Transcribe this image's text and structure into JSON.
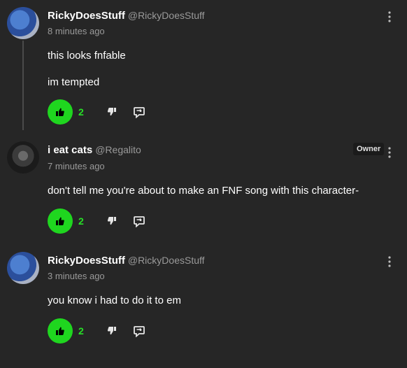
{
  "comments": [
    {
      "author": "RickyDoesStuff",
      "handle": "@RickyDoesStuff",
      "time": "8 minutes ago",
      "lines": [
        "this looks fnfable",
        "im tempted"
      ],
      "likes": "2"
    },
    {
      "author": "i eat cats",
      "handle": "@Regalito",
      "time": "7 minutes ago",
      "badge": "Owner",
      "lines": [
        "don't tell me you're about to make an FNF song with this character-"
      ],
      "likes": "2"
    },
    {
      "author": "RickyDoesStuff",
      "handle": "@RickyDoesStuff",
      "time": "3 minutes ago",
      "lines": [
        "you know i had to do it to em"
      ],
      "likes": "2"
    }
  ],
  "icons": {
    "like": "thumbs-up-icon",
    "dislike": "thumbs-down-icon",
    "reply": "reply-icon",
    "menu": "more-vertical-icon"
  },
  "colors": {
    "background": "#262626",
    "like_green": "#1fd61f",
    "muted_text": "#9a9a9a"
  }
}
